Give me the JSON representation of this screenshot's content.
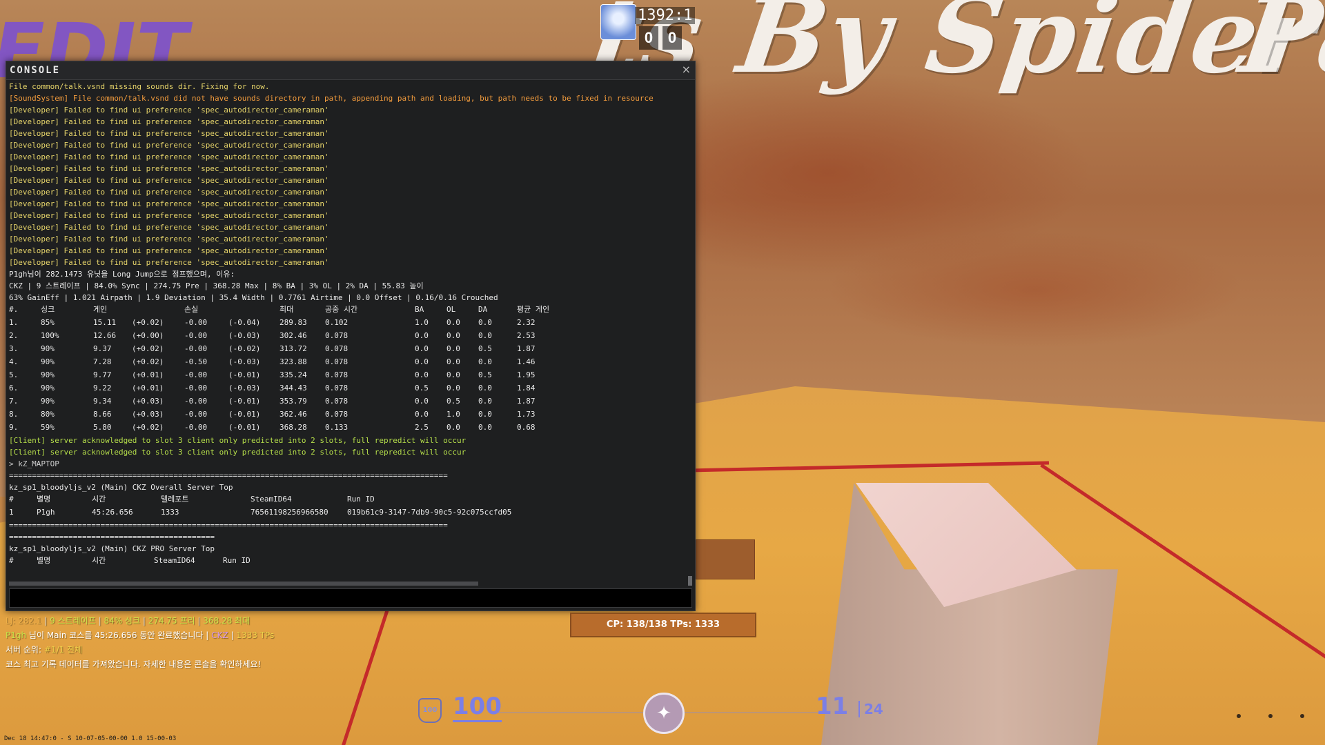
{
  "world": {
    "graffiti_main": "ts By Spider",
    "graffiti_right": "Pa",
    "graffiti_left": "EDIT"
  },
  "hud_top": {
    "timer": "1392:1",
    "score_ct": "0",
    "score_t": "0"
  },
  "console": {
    "title": "CONSOLE",
    "close": "×",
    "lines": [
      {
        "text": "File common/talk.vsnd missing sounds dir. Fixing for now.",
        "color": "yellow"
      },
      {
        "text": "[SoundSystem] File common/talk.vsnd did not have sounds directory in path, appending path and loading, but path needs to be fixed in resource",
        "color": "orange"
      },
      {
        "text": "[Developer] Failed to find ui preference 'spec_autodirector_cameraman'",
        "color": "yellow"
      },
      {
        "text": "[Developer] Failed to find ui preference 'spec_autodirector_cameraman'",
        "color": "yellow"
      },
      {
        "text": "[Developer] Failed to find ui preference 'spec_autodirector_cameraman'",
        "color": "yellow"
      },
      {
        "text": "[Developer] Failed to find ui preference 'spec_autodirector_cameraman'",
        "color": "yellow"
      },
      {
        "text": "[Developer] Failed to find ui preference 'spec_autodirector_cameraman'",
        "color": "yellow"
      },
      {
        "text": "[Developer] Failed to find ui preference 'spec_autodirector_cameraman'",
        "color": "yellow"
      },
      {
        "text": "[Developer] Failed to find ui preference 'spec_autodirector_cameraman'",
        "color": "yellow"
      },
      {
        "text": "[Developer] Failed to find ui preference 'spec_autodirector_cameraman'",
        "color": "yellow"
      },
      {
        "text": "[Developer] Failed to find ui preference 'spec_autodirector_cameraman'",
        "color": "yellow"
      },
      {
        "text": "[Developer] Failed to find ui preference 'spec_autodirector_cameraman'",
        "color": "yellow"
      },
      {
        "text": "[Developer] Failed to find ui preference 'spec_autodirector_cameraman'",
        "color": "yellow"
      },
      {
        "text": "[Developer] Failed to find ui preference 'spec_autodirector_cameraman'",
        "color": "yellow"
      },
      {
        "text": "[Developer] Failed to find ui preference 'spec_autodirector_cameraman'",
        "color": "yellow"
      },
      {
        "text": "[Developer] Failed to find ui preference 'spec_autodirector_cameraman'",
        "color": "yellow"
      },
      {
        "text": "P1gh님이 282.1473 유닛을 Long Jump으로 점프했으며, 이유:",
        "color": "white"
      },
      {
        "text": "CKZ | 9 스트레이프 | 84.0% Sync | 274.75 Pre | 368.28 Max | 8% BA | 3% OL | 2% DA | 55.83 높이",
        "color": "white"
      },
      {
        "text": "63% GainEff | 1.021 Airpath | 1.9 Deviation | 35.4 Width | 0.7761 Airtime | 0.0 Offset | 0.16/0.16 Crouched",
        "color": "white"
      }
    ],
    "strafe_table": {
      "headers": [
        "#.",
        "싱크",
        "게인",
        "",
        "손실",
        "",
        "최대",
        "공중 시간",
        "BA",
        "OL",
        "DA",
        "평균 게인"
      ],
      "rows": [
        [
          "1.",
          "85%",
          "15.11",
          "(+0.02)",
          "-0.00",
          "(-0.04)",
          "289.83",
          "0.102",
          "1.0",
          "0.0",
          "0.0",
          "2.32"
        ],
        [
          "2.",
          "100%",
          "12.66",
          "(+0.00)",
          "-0.00",
          "(-0.03)",
          "302.46",
          "0.078",
          "0.0",
          "0.0",
          "0.0",
          "2.53"
        ],
        [
          "3.",
          "90%",
          "9.37",
          "(+0.02)",
          "-0.00",
          "(-0.02)",
          "313.72",
          "0.078",
          "0.0",
          "0.0",
          "0.5",
          "1.87"
        ],
        [
          "4.",
          "90%",
          "7.28",
          "(+0.02)",
          "-0.50",
          "(-0.03)",
          "323.88",
          "0.078",
          "0.0",
          "0.0",
          "0.0",
          "1.46"
        ],
        [
          "5.",
          "90%",
          "9.77",
          "(+0.01)",
          "-0.00",
          "(-0.01)",
          "335.24",
          "0.078",
          "0.0",
          "0.0",
          "0.5",
          "1.95"
        ],
        [
          "6.",
          "90%",
          "9.22",
          "(+0.01)",
          "-0.00",
          "(-0.03)",
          "344.43",
          "0.078",
          "0.5",
          "0.0",
          "0.0",
          "1.84"
        ],
        [
          "7.",
          "90%",
          "9.34",
          "(+0.03)",
          "-0.00",
          "(-0.01)",
          "353.79",
          "0.078",
          "0.0",
          "0.5",
          "0.0",
          "1.87"
        ],
        [
          "8.",
          "80%",
          "8.66",
          "(+0.03)",
          "-0.00",
          "(-0.01)",
          "362.46",
          "0.078",
          "0.0",
          "1.0",
          "0.0",
          "1.73"
        ],
        [
          "9.",
          "59%",
          "5.80",
          "(+0.02)",
          "-0.00",
          "(-0.01)",
          "368.28",
          "0.133",
          "2.5",
          "0.0",
          "0.0",
          "0.68"
        ]
      ]
    },
    "client_lines": [
      "[Client] server acknowledged to slot 3 client only predicted into 2 slots, full repredict will occur",
      "[Client] server acknowledged to slot 3 client only predicted into 2 slots, full repredict will occur"
    ],
    "command": "> kZ_MAPTOP",
    "separator_long": "================================================================================================",
    "separator_short": "=============================================",
    "overall_title": "kz_sp1_bloodyljs_v2 (Main) CKZ Overall Server Top",
    "overall_headers": [
      "#",
      "별명",
      "시간",
      "텔레포트",
      "SteamID64",
      "Run ID"
    ],
    "overall_row": [
      "1",
      "P1gh",
      "45:26.656",
      "1333",
      "76561198256966580",
      "019b61c9-3147-7db9-90c5-92c075ccfd05"
    ],
    "pro_title": "kz_sp1_bloodyljs_v2 (Main) CKZ PRO Server Top",
    "pro_headers": [
      "#",
      "별명",
      "시간",
      "SteamID64",
      "Run ID"
    ],
    "input_value": ""
  },
  "chat": {
    "line1": [
      {
        "text": "LJ: 282.1",
        "color": "#f0b24a"
      },
      {
        "text": " | ",
        "color": "#cfcfcf"
      },
      {
        "text": "9 스트레이프",
        "color": "#c8e34a"
      },
      {
        "text": " | ",
        "color": "#cfcfcf"
      },
      {
        "text": "84% 싱크",
        "color": "#c8e34a"
      },
      {
        "text": " | ",
        "color": "#cfcfcf"
      },
      {
        "text": "274.75 프리",
        "color": "#c8e34a"
      },
      {
        "text": " | ",
        "color": "#cfcfcf"
      },
      {
        "text": "368.28 최대",
        "color": "#c8e34a"
      }
    ],
    "line2": [
      {
        "text": "P1gh",
        "color": "#c8e34a"
      },
      {
        "text": " 님이 ",
        "color": "#ffffff"
      },
      {
        "text": "Main",
        "color": "#ffffff"
      },
      {
        "text": " 코스를 ",
        "color": "#ffffff"
      },
      {
        "text": "45:26.656",
        "color": "#ffffff"
      },
      {
        "text": " 동안 완료했습니다 | ",
        "color": "#ffffff"
      },
      {
        "text": "CKZ",
        "color": "#d79ae6"
      },
      {
        "text": " | ",
        "color": "#ffffff"
      },
      {
        "text": "1333 TPs",
        "color": "#f0d24a"
      }
    ],
    "line3": [
      {
        "text": "서버 순위: ",
        "color": "#ffffff"
      },
      {
        "text": "#1/1 전체",
        "color": "#f0d24a"
      }
    ],
    "line4": [
      {
        "text": "코스 최고 기록 데이터를 가져왔습니다. 자세한 내용은 콘솔을 확인하세요!",
        "color": "#ffffff"
      }
    ]
  },
  "cp_box": "CP: 138/138 TPs: 1333",
  "hud_bottom": {
    "health_icon_label": "100",
    "health": "100",
    "ammo": "11",
    "ammo_reserve": "24"
  },
  "footer": "Dec 18 14:47:0 - S 10-07-05-00-00 1.0 15-00-03"
}
